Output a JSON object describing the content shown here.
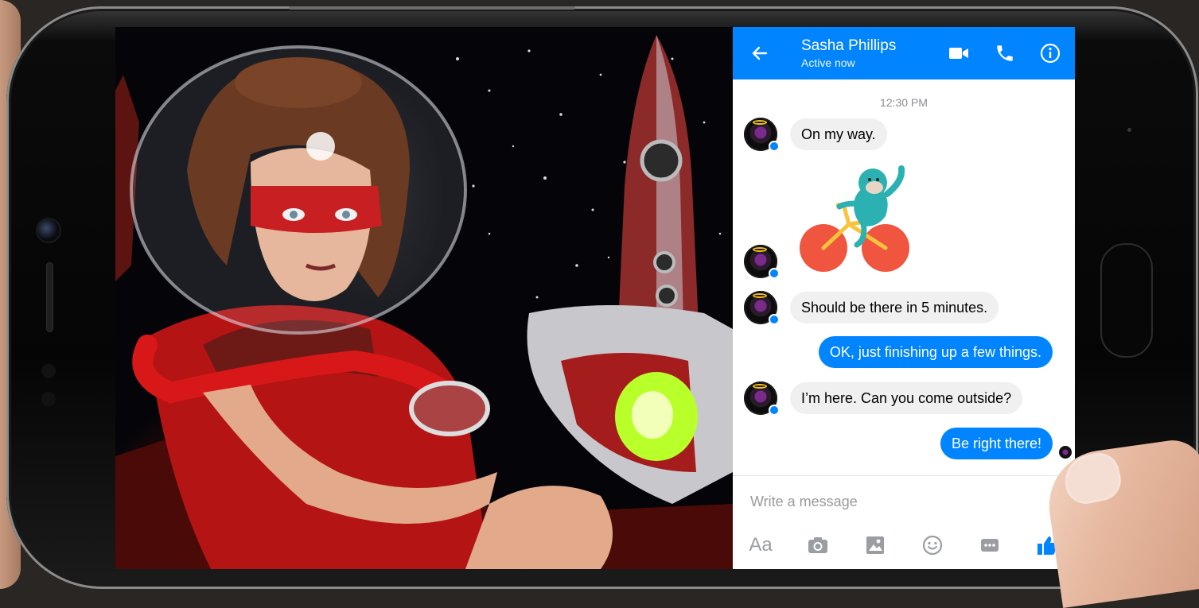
{
  "header": {
    "contact_name": "Sasha Phillips",
    "status": "Active now",
    "icons": [
      "back-arrow-icon",
      "video-call-icon",
      "phone-call-icon",
      "info-icon"
    ]
  },
  "thread": {
    "timestamp": "12:30 PM",
    "messages": [
      {
        "from": "contact",
        "text": "On my way."
      },
      {
        "from": "contact",
        "sticker": "monkey-on-bicycle-sticker"
      },
      {
        "from": "contact",
        "text": "Should be there in 5 minutes."
      },
      {
        "from": "me",
        "text": "OK, just finishing up a few things."
      },
      {
        "from": "contact",
        "text": "I’m here. Can you come outside?"
      },
      {
        "from": "me",
        "text": "Be right there!"
      }
    ]
  },
  "composer": {
    "placeholder": "Write a message",
    "font_button_label": "Aa",
    "tools": [
      "camera-icon",
      "gallery-icon",
      "emoji-icon",
      "more-icon",
      "like-thumb-icon"
    ]
  },
  "colors": {
    "brand_blue": "#0084ff",
    "incoming_bubble": "#f1f0f0",
    "timestamp_gray": "#8b8d91"
  }
}
